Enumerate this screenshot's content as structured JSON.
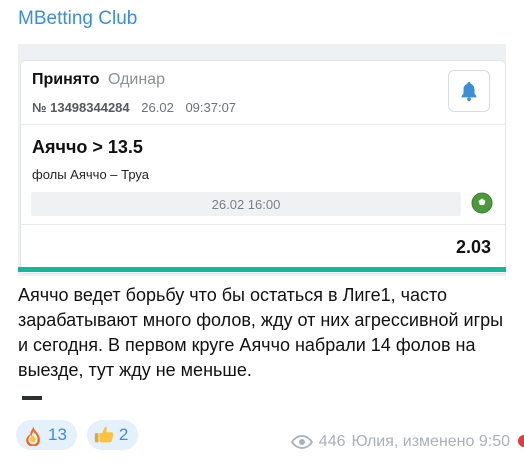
{
  "channel": {
    "name": "MBetting Club"
  },
  "bet": {
    "status": "Принято",
    "type": "Одинар",
    "ticket_number": "№ 13498344284",
    "date": "26.02",
    "time": "09:37:07",
    "selection": "Аяччо > 13.5",
    "market": "фолы Аяччо – Труа",
    "event_datetime": "26.02 16:00",
    "odds": "2.03"
  },
  "message": {
    "text": "Аяччо ведет борьбу что бы остаться в Лиге1, часто зарабатывают много фолов, жду от них агрессивной игры и сегодня. В первом круге Аяччо набрали 14 фолов на выезде, тут жду не меньше."
  },
  "reactions": [
    {
      "emoji": "fire-icon",
      "count": "13"
    },
    {
      "emoji": "thumbs-up-icon",
      "count": "2"
    }
  ],
  "meta": {
    "views": "446",
    "author_edited": "Юлия, изменено 9:50"
  },
  "colors": {
    "accent": "#3a8fd6",
    "teal": "#12b89a",
    "reaction_bg": "#e4f0fb"
  }
}
